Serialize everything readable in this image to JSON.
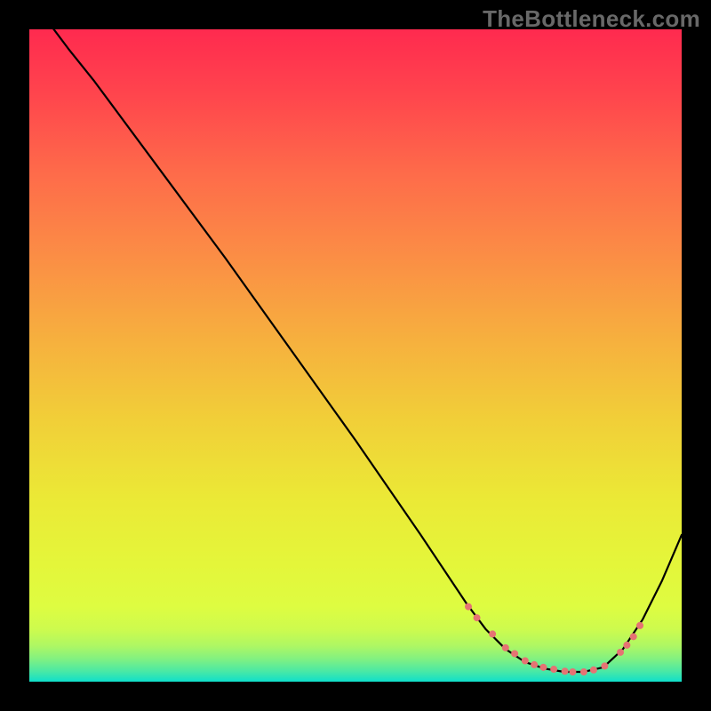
{
  "watermark": "TheBottleneck.com",
  "chart_data": {
    "type": "line",
    "title": "",
    "xlabel": "",
    "ylabel": "",
    "xlim": [
      0,
      100
    ],
    "ylim": [
      0,
      100
    ],
    "grid": false,
    "curve": {
      "x": [
        0,
        3,
        6,
        10,
        20,
        30,
        40,
        50,
        60,
        67,
        70,
        73,
        76,
        79,
        82,
        85,
        88,
        91,
        94,
        97,
        100
      ],
      "y": [
        105,
        101,
        97,
        92,
        78.5,
        65,
        51,
        37,
        22.5,
        12,
        8,
        5,
        3,
        2,
        1.5,
        1.5,
        2.2,
        5,
        9.5,
        15.5,
        22.5
      ]
    },
    "markers": {
      "color": "#E57373",
      "radius": 4,
      "points_x": [
        67.3,
        68.6,
        71,
        73,
        74.4,
        76,
        77.4,
        78.8,
        80.4,
        82.1,
        83.3,
        85,
        86.5,
        88.2,
        90.6,
        91.6,
        92.6,
        93.6
      ],
      "points_y": [
        11.5,
        9.8,
        7.3,
        5.2,
        4.3,
        3.2,
        2.6,
        2.2,
        1.9,
        1.6,
        1.5,
        1.5,
        1.8,
        2.4,
        4.5,
        5.6,
        6.9,
        8.6
      ]
    },
    "background_gradient": [
      {
        "offset": 0.0,
        "color": "#FF2A4F"
      },
      {
        "offset": 0.1,
        "color": "#FF454D"
      },
      {
        "offset": 0.22,
        "color": "#FE6B4A"
      },
      {
        "offset": 0.35,
        "color": "#FB8E45"
      },
      {
        "offset": 0.48,
        "color": "#F6B13E"
      },
      {
        "offset": 0.6,
        "color": "#F1CF38"
      },
      {
        "offset": 0.72,
        "color": "#EBE936"
      },
      {
        "offset": 0.82,
        "color": "#E4F63A"
      },
      {
        "offset": 0.885,
        "color": "#DEFC41"
      },
      {
        "offset": 0.92,
        "color": "#CDFB4E"
      },
      {
        "offset": 0.945,
        "color": "#AEF763"
      },
      {
        "offset": 0.965,
        "color": "#82F181"
      },
      {
        "offset": 0.985,
        "color": "#47E8A7"
      },
      {
        "offset": 1.0,
        "color": "#10DFCB"
      }
    ]
  }
}
